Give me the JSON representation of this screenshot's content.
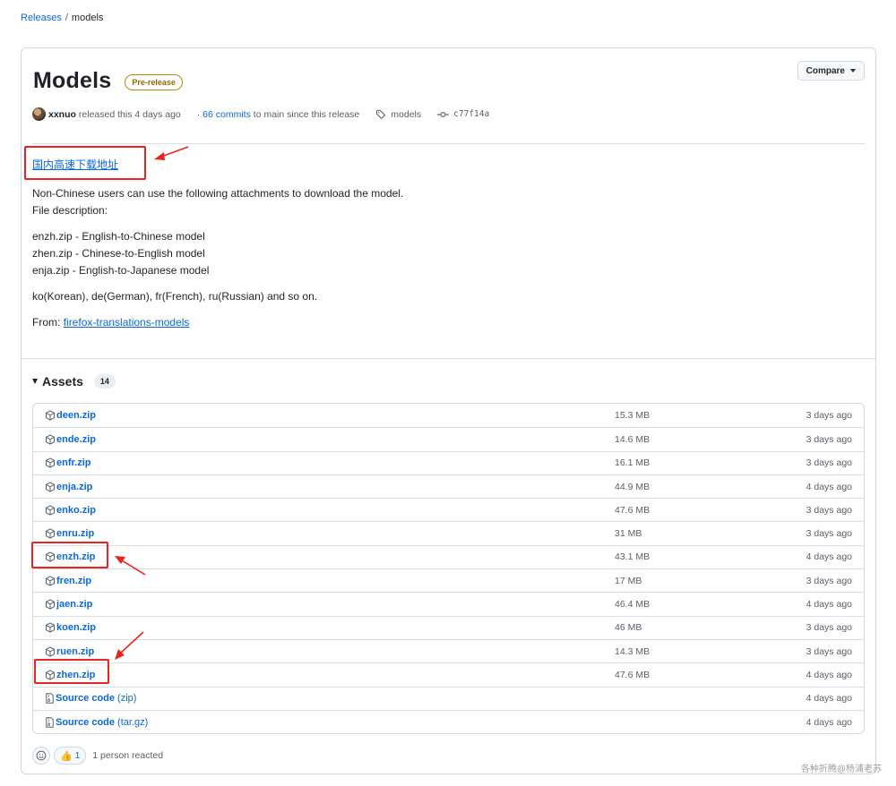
{
  "breadcrumb": {
    "root": "Releases",
    "separator": "/",
    "current": "models"
  },
  "release": {
    "title": "Models",
    "badge": "Pre-release",
    "compare_label": "Compare",
    "author": "xxnuo",
    "released_text": "released this 4 days ago",
    "commits_count": "66 commits",
    "commits_prefix": "·",
    "commits_suffix": "to main since this release",
    "tag": "models",
    "commit_hash": "c77f14a"
  },
  "body": {
    "mirror_link": "国内高速下载地址",
    "line1": "Non-Chinese users can use the following attachments to download the model.",
    "line2": "File description:",
    "desc1": "enzh.zip - English-to-Chinese model",
    "desc2": "zhen.zip - Chinese-to-English model",
    "desc3": "enja.zip - English-to-Japanese model",
    "others": "ko(Korean), de(German), fr(French), ru(Russian) and so on.",
    "from_label": "From:",
    "from_link": "firefox-translations-models"
  },
  "assets": {
    "title": "Assets",
    "count": "14",
    "rows": [
      {
        "name": "deen.zip",
        "size": "15.3 MB",
        "date": "3 days ago",
        "icon": "package-icon"
      },
      {
        "name": "ende.zip",
        "size": "14.6 MB",
        "date": "3 days ago",
        "icon": "package-icon"
      },
      {
        "name": "enfr.zip",
        "size": "16.1 MB",
        "date": "3 days ago",
        "icon": "package-icon"
      },
      {
        "name": "enja.zip",
        "size": "44.9 MB",
        "date": "4 days ago",
        "icon": "package-icon"
      },
      {
        "name": "enko.zip",
        "size": "47.6 MB",
        "date": "3 days ago",
        "icon": "package-icon"
      },
      {
        "name": "enru.zip",
        "size": "31 MB",
        "date": "3 days ago",
        "icon": "package-icon"
      },
      {
        "name": "enzh.zip",
        "size": "43.1 MB",
        "date": "4 days ago",
        "icon": "package-icon"
      },
      {
        "name": "fren.zip",
        "size": "17 MB",
        "date": "3 days ago",
        "icon": "package-icon"
      },
      {
        "name": "jaen.zip",
        "size": "46.4 MB",
        "date": "4 days ago",
        "icon": "package-icon"
      },
      {
        "name": "koen.zip",
        "size": "46 MB",
        "date": "3 days ago",
        "icon": "package-icon"
      },
      {
        "name": "ruen.zip",
        "size": "14.3 MB",
        "date": "3 days ago",
        "icon": "package-icon"
      },
      {
        "name": "zhen.zip",
        "size": "47.6 MB",
        "date": "4 days ago",
        "icon": "package-icon"
      },
      {
        "name": "Source code",
        "suffix": "(zip)",
        "size": "",
        "date": "4 days ago",
        "icon": "file-zip-icon"
      },
      {
        "name": "Source code",
        "suffix": "(tar.gz)",
        "size": "",
        "date": "4 days ago",
        "icon": "file-zip-icon"
      }
    ]
  },
  "reactions": {
    "thumbs_count": "1",
    "text": "1 person reacted"
  },
  "watermark": "各种折腾@杨浦老苏",
  "colors": {
    "link": "#0969da",
    "annotation_red": "#e8261d",
    "badge_border": "#bf8700"
  }
}
